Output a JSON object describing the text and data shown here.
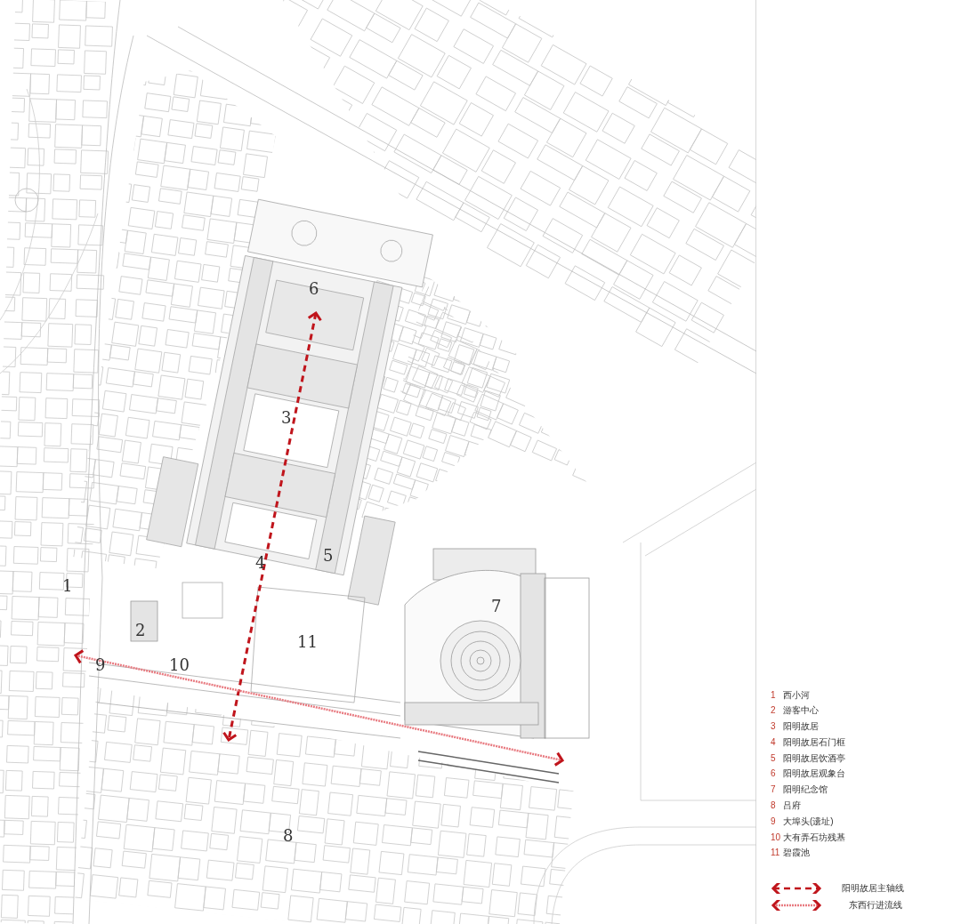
{
  "site_plan": {
    "labels": [
      {
        "text": "1"
      },
      {
        "text": "2"
      },
      {
        "text": "3"
      },
      {
        "text": "4"
      },
      {
        "text": "5"
      },
      {
        "text": "6"
      },
      {
        "text": "7"
      },
      {
        "text": "8"
      },
      {
        "text": "9"
      },
      {
        "text": "10"
      },
      {
        "text": "11"
      }
    ],
    "routes": [
      {
        "kind": "axis"
      },
      {
        "kind": "flow"
      }
    ]
  },
  "legend": {
    "items": [
      {
        "number": "1",
        "name": "西小河"
      },
      {
        "number": "2",
        "name": "游客中心"
      },
      {
        "number": "3",
        "name": "阳明故居"
      },
      {
        "number": "4",
        "name": "阳明故居石门框"
      },
      {
        "number": "5",
        "name": "阳明故居饮酒亭"
      },
      {
        "number": "6",
        "name": "阳明故居观象台"
      },
      {
        "number": "7",
        "name": "阳明纪念馆"
      },
      {
        "number": "8",
        "name": "吕府"
      },
      {
        "number": "9",
        "name": "大埠头(遗址)"
      },
      {
        "number": "10",
        "name": "大有弄石坊残基"
      },
      {
        "number": "11",
        "name": "碧霞池"
      }
    ],
    "lines": [
      {
        "kind": "axis",
        "name": "阳明故居主轴线"
      },
      {
        "kind": "flow",
        "name": "东西行进流线"
      }
    ]
  }
}
